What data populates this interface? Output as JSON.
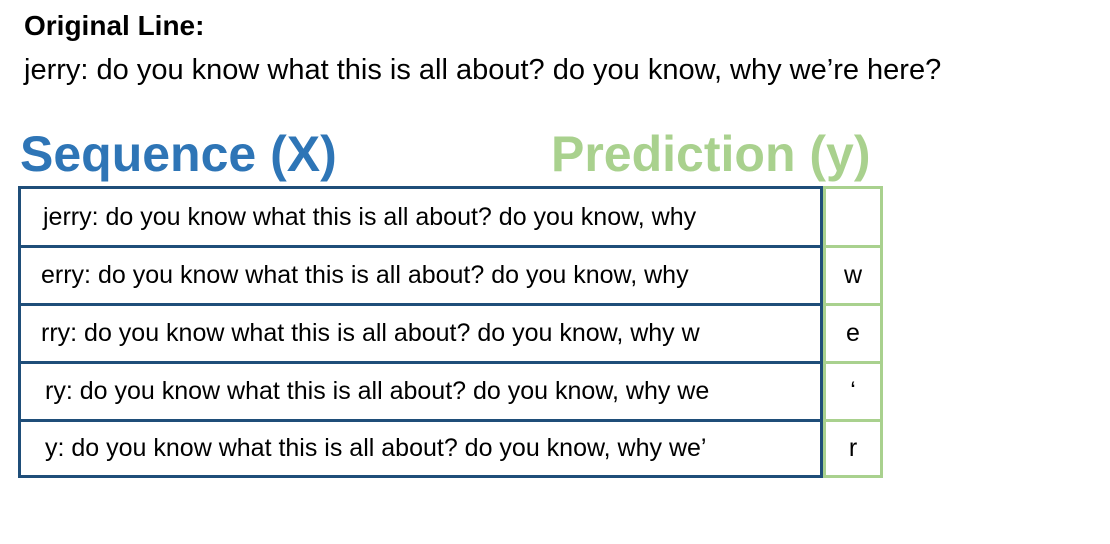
{
  "original": {
    "heading": "Original Line:",
    "text": "jerry: do you know what this is all about? do you know, why we’re here?"
  },
  "headings": {
    "sequence": "Sequence (X)",
    "prediction": "Prediction (y)"
  },
  "colors": {
    "sequence_heading": "#2e75b6",
    "sequence_border": "#1f4e79",
    "prediction": "#a9d18e"
  },
  "rows": [
    {
      "sequence": "jerry: do you know what this is all about? do you know, why",
      "prediction": ""
    },
    {
      "sequence": "erry: do you know what this is all about? do you know, why",
      "prediction": "w"
    },
    {
      "sequence": "rry: do you know what this is all about? do you know, why w",
      "prediction": "e"
    },
    {
      "sequence": "ry: do you know what this is all about? do you know, why we",
      "prediction": "‘"
    },
    {
      "sequence": "y: do you know what this is all about? do you know, why we’",
      "prediction": "r"
    }
  ]
}
